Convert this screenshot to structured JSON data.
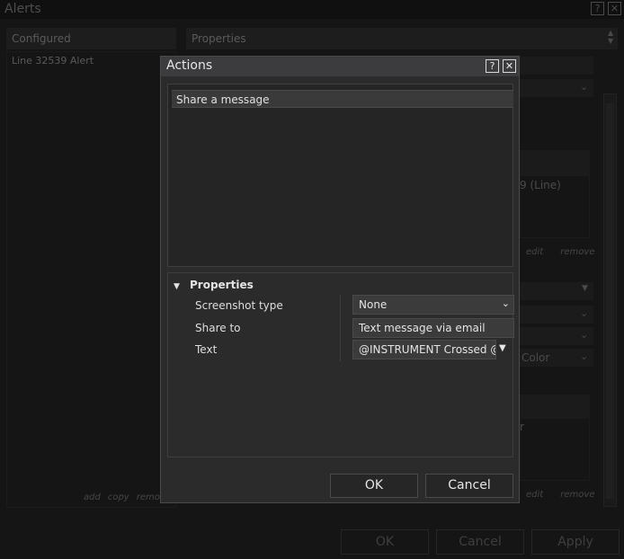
{
  "alerts_window": {
    "title": "Alerts",
    "help_button": "?",
    "close_button": "✕",
    "configured_header": "Configured",
    "configured_items": [
      "Line 32539 Alert"
    ],
    "list_actions": [
      "add",
      "copy",
      "remo"
    ],
    "properties_header": "Properties",
    "partial_line_label": "9 (Line)",
    "partial_color_label": "Color",
    "partial_r_label": "r",
    "right_actions_top": [
      "edit",
      "remove"
    ],
    "right_actions_bottom": [
      "edit",
      "remove"
    ],
    "buttons": {
      "ok": "OK",
      "cancel": "Cancel",
      "apply": "Apply"
    }
  },
  "actions_dialog": {
    "title": "Actions",
    "help_button": "?",
    "close_button": "✕",
    "actions": [
      {
        "label": "Share a message"
      }
    ],
    "properties": {
      "header": "Properties",
      "rows": [
        {
          "label": "Screenshot type",
          "value": "None"
        },
        {
          "label": "Share to",
          "value": "Text message via email"
        },
        {
          "label": "Text",
          "value": "@INSTRUMENT Crossed @"
        }
      ]
    },
    "buttons": {
      "ok": "OK",
      "cancel": "Cancel"
    }
  },
  "colors": {
    "dialog_bg": "#2b2b2c",
    "title_bar": "#3c3c3e",
    "selected_row": "#3a3a3b",
    "backdrop": "#151515"
  }
}
